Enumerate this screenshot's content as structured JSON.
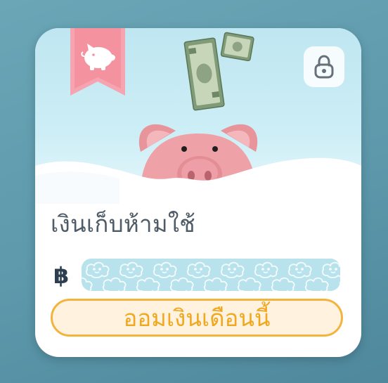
{
  "card": {
    "title": "เงินเก็บห้ามใช้",
    "currency_symbol": "฿",
    "amount_masked": true,
    "save_button_label": "ออมเงินเดือนนี้",
    "ribbon_icon": "piggy-bank-icon",
    "lock_icon": "padlock-icon"
  },
  "colors": {
    "accent": "#f2b43c",
    "button_bg": "#fff3e0",
    "ribbon": "#f6a5b0",
    "mask": "#b9e3ec"
  }
}
